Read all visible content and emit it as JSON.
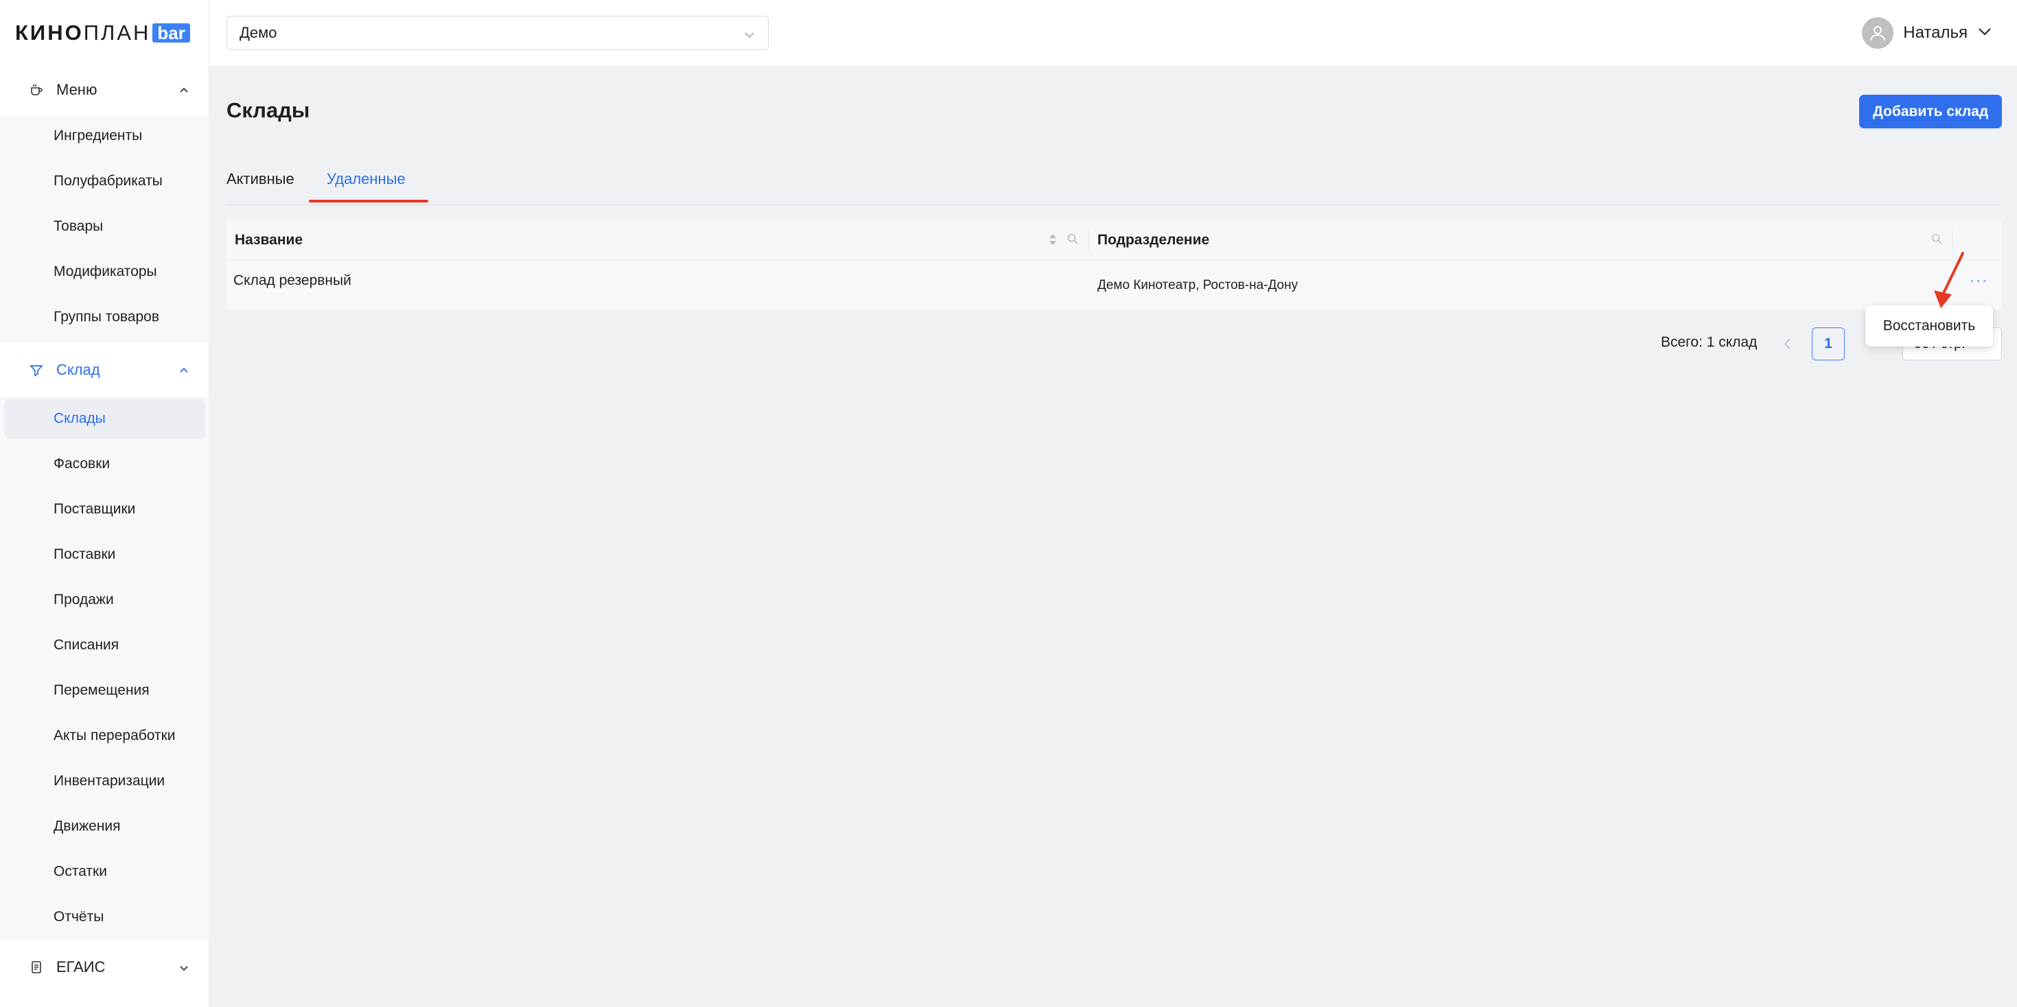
{
  "logo": {
    "brand_bold": "КИНО",
    "brand_thin": "ПЛАН",
    "badge": "bar"
  },
  "sidebar": {
    "menu": {
      "label": "Меню",
      "items": [
        "Ингредиенты",
        "Полуфабрикаты",
        "Товары",
        "Модификаторы",
        "Группы товаров"
      ]
    },
    "warehouse": {
      "label": "Склад",
      "items": [
        "Склады",
        "Фасовки",
        "Поставщики",
        "Поставки",
        "Продажи",
        "Списания",
        "Перемещения",
        "Акты переработки",
        "Инвентаризации",
        "Движения",
        "Остатки",
        "Отчёты"
      ],
      "selected": "Склады"
    },
    "egais": {
      "label": "ЕГАИС"
    }
  },
  "header": {
    "organization_select": "Демо",
    "user_name": "Наталья"
  },
  "page": {
    "title": "Склады",
    "add_button": "Добавить склад",
    "tabs": [
      "Активные",
      "Удаленные"
    ],
    "active_tab": "Удаленные"
  },
  "table": {
    "columns": [
      "Название",
      "Подразделение"
    ],
    "rows": [
      {
        "name": "Склад резервный",
        "division": "Демо Кинотеатр, Ростов-на-Дону",
        "actions": "···"
      }
    ]
  },
  "pagination": {
    "total": "Всего: 1 склад",
    "current_page": "1",
    "per_page": "50 / стр."
  },
  "context_menu": {
    "restore": "Восстановить"
  },
  "colors": {
    "accent": "#2f6fed",
    "annotation": "#e53a25"
  }
}
